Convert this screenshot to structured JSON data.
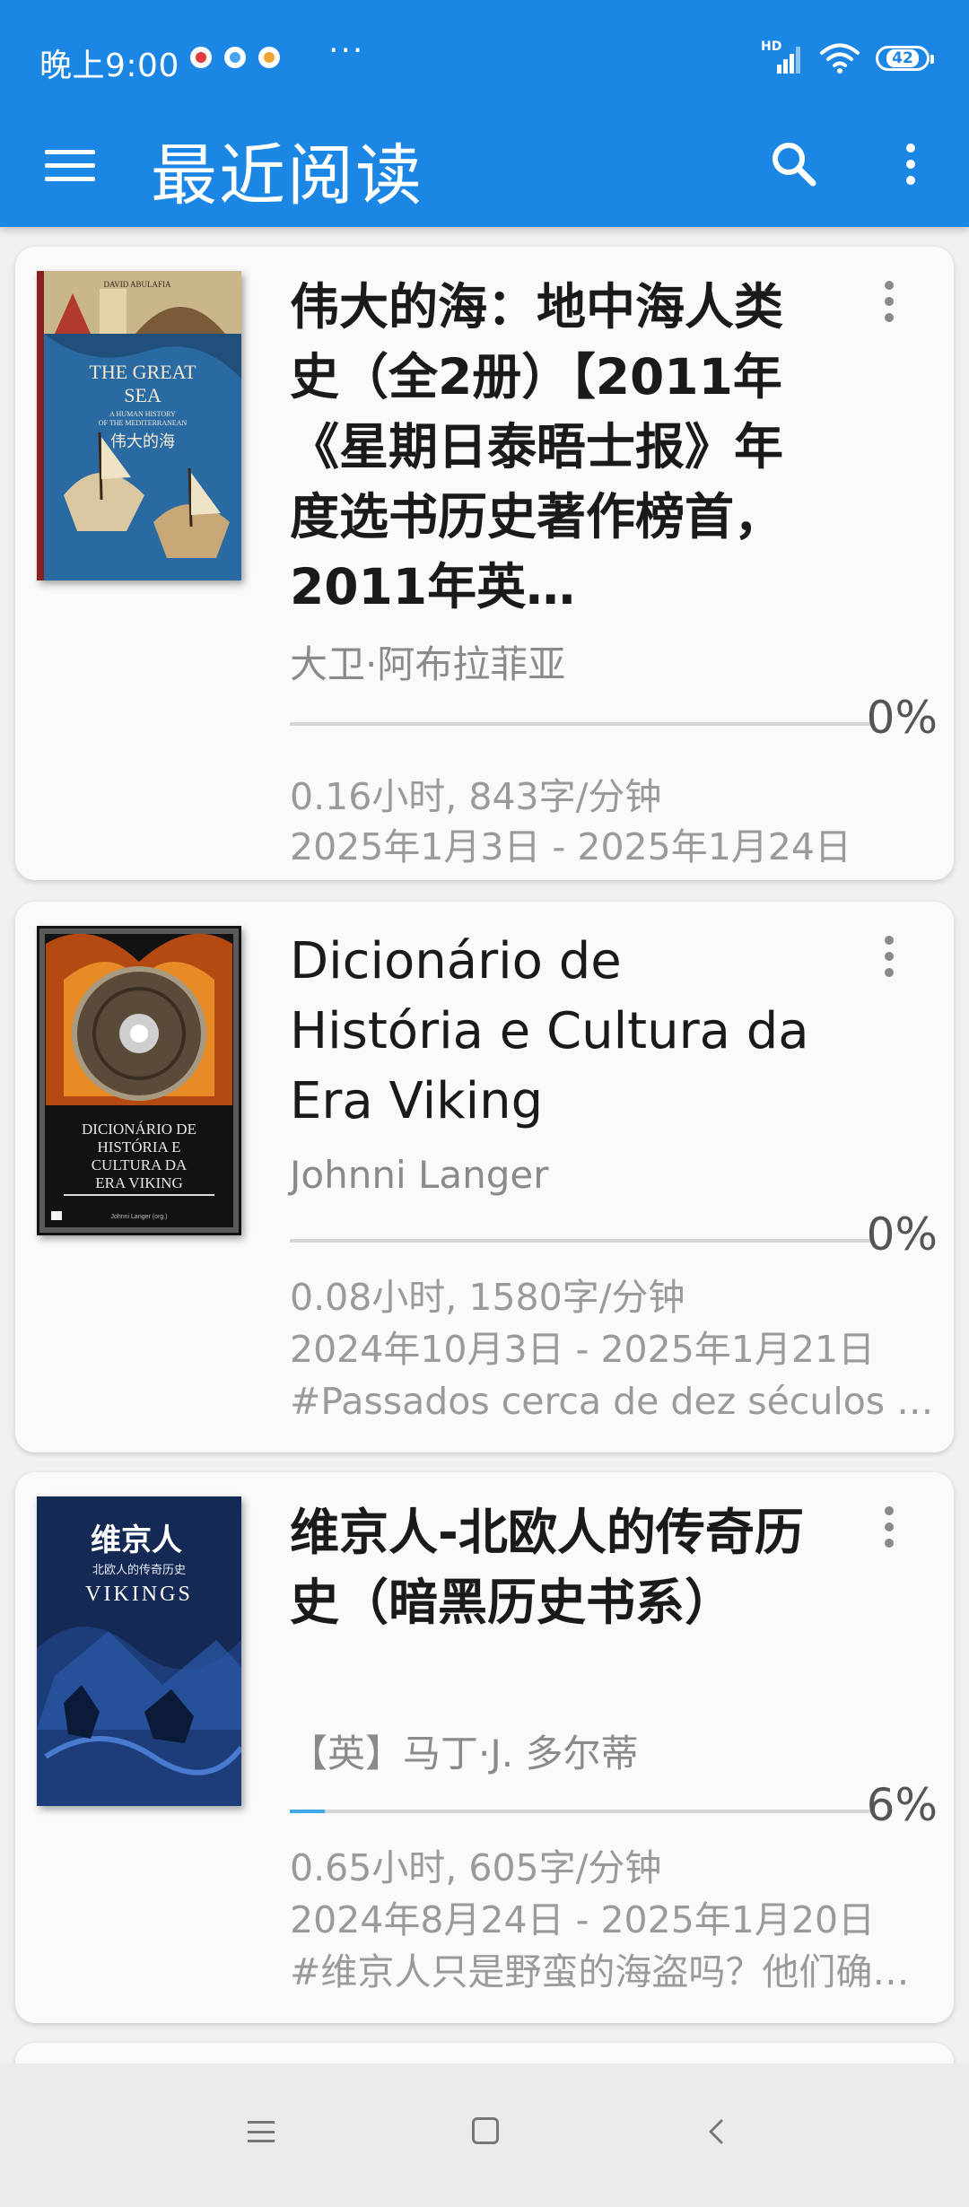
{
  "status_bar": {
    "time": "晚上9:00",
    "more": "···",
    "network": "HD",
    "battery": "42"
  },
  "app_bar": {
    "title": "最近阅读",
    "icons": [
      "menu-icon",
      "search-icon",
      "overflow-icon"
    ]
  },
  "books": [
    {
      "title": "伟大的海：地中海人类史（全2册）【2011年《星期日泰晤士报》年度选书历史著作榜首，2011年英…",
      "author": "大卫·阿布拉菲亚",
      "progress_percent": 0,
      "progress_label": "0%",
      "stats": "0.16小时, 843字/分钟",
      "dates": "2025年1月3日 - 2025年1月24日",
      "note": "",
      "cover_text": [
        "DAVID ABULAFIA",
        "THE GREAT",
        "SEA",
        "A HUMAN HISTORY",
        "OF THE MEDITERRANEAN",
        "伟大的海"
      ]
    },
    {
      "title": "Dicionário de História e Cultura da Era Viking",
      "author": "Johnni Langer",
      "progress_percent": 0,
      "progress_label": "0%",
      "stats": "0.08小时, 1580字/分钟",
      "dates": "2024年10月3日 - 2025年1月21日",
      "note": "#Passados cerca de dez séculos d…",
      "cover_text": [
        "DICIONÁRIO DE",
        "HISTÓRIA E",
        "CULTURA DA",
        "ERA VIKING",
        "Johnni Langer (org.)"
      ]
    },
    {
      "title": "维京人-北欧人的传奇历史（暗黑历史书系）",
      "author": "【英】马丁·J. 多尔蒂",
      "progress_percent": 6,
      "progress_label": "6%",
      "stats": "0.65小时, 605字/分钟",
      "dates": "2024年8月24日 - 2025年1月20日",
      "note": "#维京人只是野蛮的海盗吗？他们确…",
      "cover_text": [
        "维京人",
        "北欧人的传奇历史",
        "VIKINGS"
      ]
    }
  ],
  "nav_bar": {
    "icons": [
      "recents-icon",
      "home-icon",
      "back-icon"
    ]
  },
  "colors": {
    "primary": "#1c86e5",
    "progress": "#3ea7e8",
    "card_bg": "#fafafa",
    "page_bg": "#f0f0f0"
  }
}
